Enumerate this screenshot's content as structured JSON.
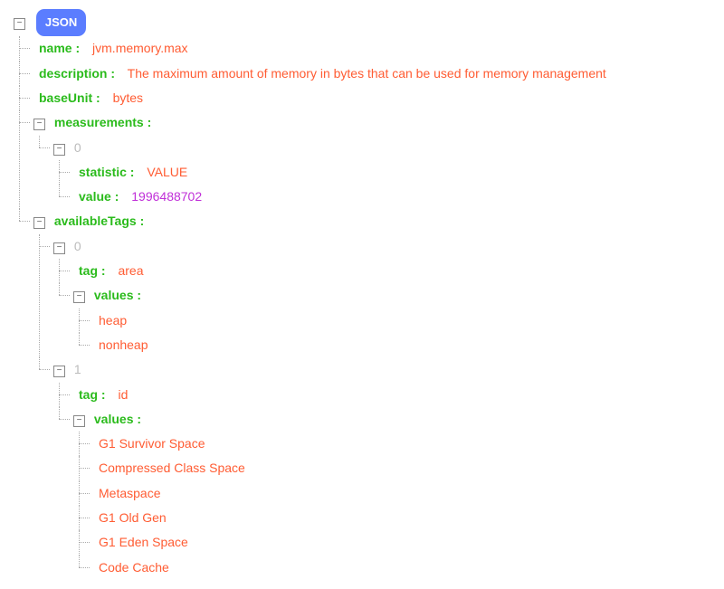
{
  "rootLabel": "JSON",
  "name_key": "name",
  "name_value": "jvm.memory.max",
  "description_key": "description",
  "description_value": "The maximum amount of memory in bytes that can be used for memory management",
  "baseUnit_key": "baseUnit",
  "baseUnit_value": "bytes",
  "measurements_key": "measurements",
  "measurements": [
    {
      "index": "0",
      "statistic_key": "statistic",
      "statistic_value": "VALUE",
      "value_key": "value",
      "value_value": "1996488702"
    }
  ],
  "availableTags_key": "availableTags",
  "availableTags": [
    {
      "index": "0",
      "tag_key": "tag",
      "tag_value": "area",
      "values_key": "values",
      "values": [
        "heap",
        "nonheap"
      ]
    },
    {
      "index": "1",
      "tag_key": "tag",
      "tag_value": "id",
      "values_key": "values",
      "values": [
        "G1 Survivor Space",
        "Compressed Class Space",
        "Metaspace",
        "G1 Old Gen",
        "G1 Eden Space",
        "Code Cache"
      ]
    }
  ]
}
